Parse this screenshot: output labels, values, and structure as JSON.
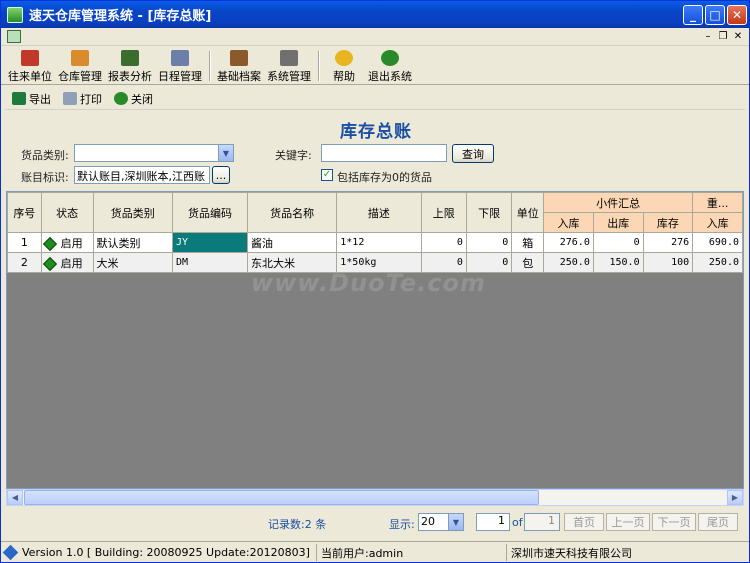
{
  "window": {
    "title": "速天仓库管理系统  - [库存总账]"
  },
  "main_toolbar": [
    {
      "key": "contacts",
      "label": "往来单位",
      "color": "#c0392b"
    },
    {
      "key": "warehouse",
      "label": "仓库管理",
      "color": "#d98c2b"
    },
    {
      "key": "reports",
      "label": "报表分析",
      "color": "#3b6e2e"
    },
    {
      "key": "schedule",
      "label": "日程管理",
      "color": "#6b7fa8"
    },
    {
      "key": "basics",
      "label": "基础档案",
      "color": "#8a5a2b"
    },
    {
      "key": "system",
      "label": "系统管理",
      "color": "#707070"
    },
    {
      "key": "help",
      "label": "帮助",
      "color": "#e8b520"
    },
    {
      "key": "exit",
      "label": "退出系统",
      "color": "#2a8a2a"
    }
  ],
  "sub_toolbar": {
    "export": "导出",
    "print": "打印",
    "close": "关闭"
  },
  "page_title": "库存总账",
  "filters": {
    "category_label": "货品类别:",
    "category_value": "",
    "keyword_label": "关键字:",
    "keyword_value": "",
    "query_button": "查询",
    "account_label": "账目标识:",
    "account_value": "默认账目,深圳账本,江西账",
    "browse_button": "...",
    "include_zero_label": "包括库存为0的货品",
    "include_zero_checked": "✓"
  },
  "table": {
    "headers": {
      "seq": "序号",
      "status": "状态",
      "category": "货品类别",
      "code": "货品编码",
      "name": "货品名称",
      "desc": "描述",
      "upper": "上限",
      "lower": "下限",
      "unit": "单位",
      "small_summary": "小件汇总",
      "in": "入库",
      "out": "出库",
      "stock": "库存",
      "weight": "重...",
      "w_in": "入库"
    },
    "rows": [
      {
        "seq": "1",
        "status": "启用",
        "category": "默认类别",
        "code": "JY",
        "name": "酱油",
        "desc": "1*12",
        "upper": "0",
        "lower": "0",
        "unit": "箱",
        "in": "276.0",
        "out": "0",
        "stock": "276",
        "w_in": "690.0"
      },
      {
        "seq": "2",
        "status": "启用",
        "category": "大米",
        "code": "DM",
        "name": "东北大米",
        "desc": "1*50kg",
        "upper": "0",
        "lower": "0",
        "unit": "包",
        "in": "250.0",
        "out": "150.0",
        "stock": "100",
        "w_in": "250.0"
      }
    ]
  },
  "watermark": "www.DuoTe.com",
  "pager": {
    "record_count": "记录数:2 条",
    "page_size_label": "显示:",
    "page_size": "20",
    "current_page": "1",
    "of_label": "of",
    "total_pages": "1",
    "first": "首页",
    "prev": "上一页",
    "next": "下一页",
    "last": "尾页"
  },
  "statusbar": {
    "version": "Version 1.0 [ Building: 20080925 Update:20120803]",
    "user": "当前用户:admin",
    "company": "深圳市速天科技有限公司"
  }
}
